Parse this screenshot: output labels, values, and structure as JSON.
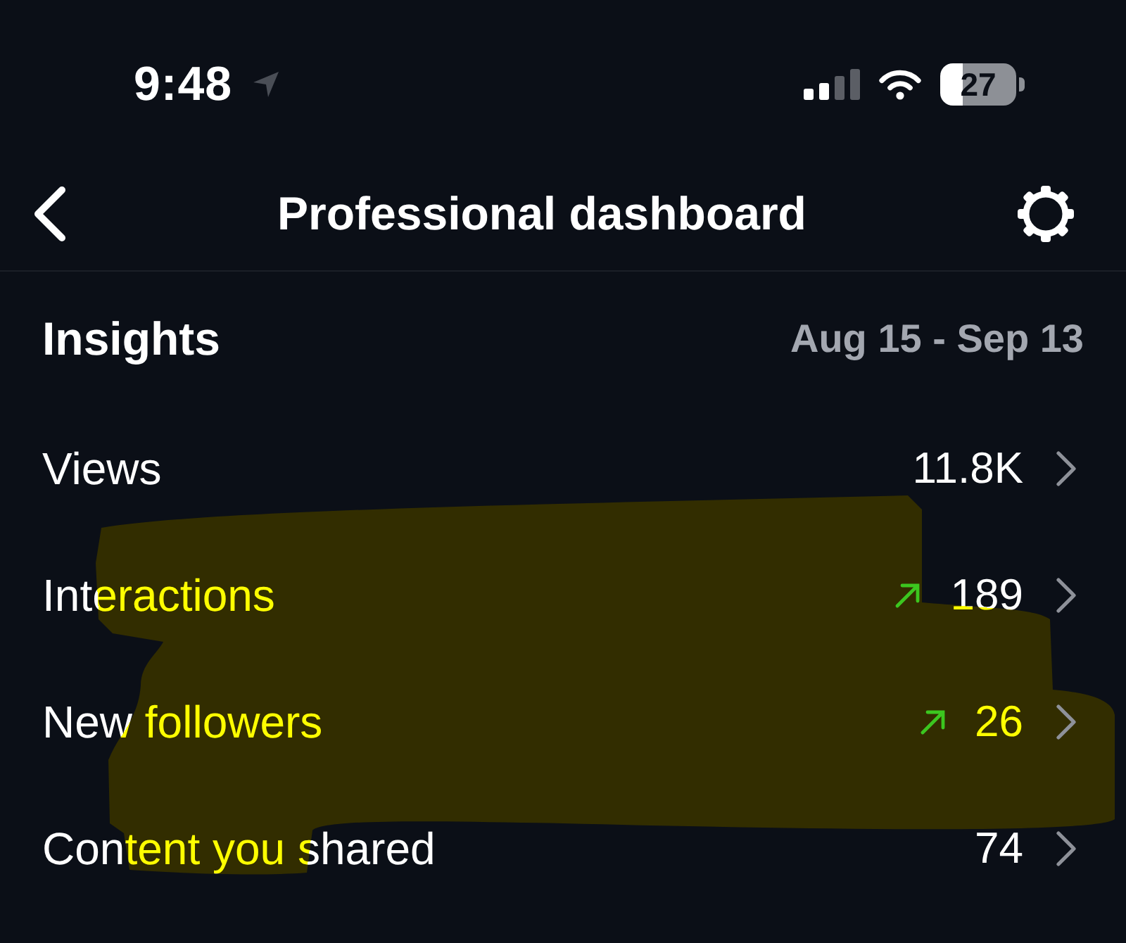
{
  "status_bar": {
    "time": "9:48",
    "battery": "27"
  },
  "header": {
    "title": "Professional dashboard"
  },
  "insights": {
    "title": "Insights",
    "date_range": "Aug 15 - Sep 13",
    "rows": [
      {
        "label": "Views",
        "value": "11.8K",
        "trend_up": false
      },
      {
        "label": "Interactions",
        "value": "189",
        "trend_up": true
      },
      {
        "label": "New followers",
        "value": "26",
        "trend_up": true
      },
      {
        "label": "Content you shared",
        "value": "74",
        "trend_up": false
      }
    ]
  },
  "highlighter_mark": true
}
